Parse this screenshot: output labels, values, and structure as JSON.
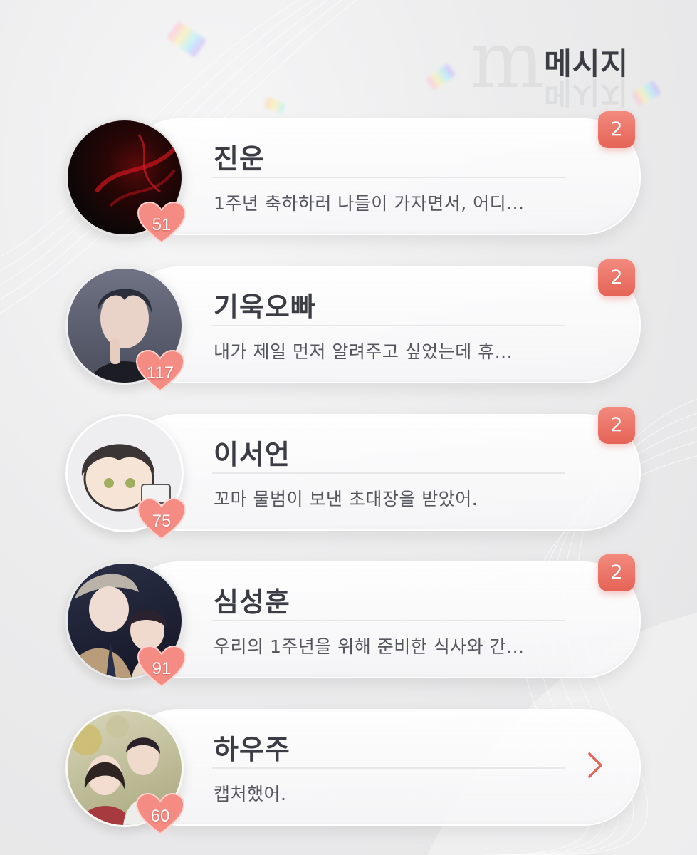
{
  "header": {
    "title": "메시지"
  },
  "colors": {
    "badge": "#e86a5c",
    "heart": "#f47f78",
    "text": "#3b3c44",
    "chevron": "#e0675b"
  },
  "messages": [
    {
      "name": "진운",
      "preview": "1주년 축하하러 나들이 가자면서, 어디...",
      "affinity": "51",
      "unread": "2"
    },
    {
      "name": "기욱오빠",
      "preview": "내가 제일 먼저 알려주고 싶었는데 휴...",
      "affinity": "117",
      "unread": "2"
    },
    {
      "name": "이서언",
      "preview": "꼬마 물범이 보낸 초대장을 받았어.",
      "affinity": "75",
      "unread": "2"
    },
    {
      "name": "심성훈",
      "preview": "우리의 1주년을 위해 준비한 식사와 간...",
      "affinity": "91",
      "unread": "2"
    },
    {
      "name": "하우주",
      "preview": "캡처했어.",
      "affinity": "60",
      "unread": "",
      "action_icon": "chevron-right-icon"
    }
  ]
}
